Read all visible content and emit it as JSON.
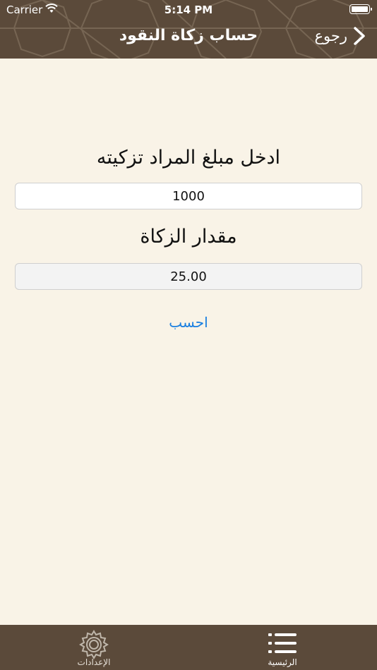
{
  "status_bar": {
    "carrier": "Carrier",
    "time": "5:14 PM"
  },
  "nav": {
    "title": "حساب زكاة النقود",
    "back_label": "رجوع"
  },
  "form": {
    "amount_label": "ادخل مبلغ المراد تزكيته",
    "amount_value": "1000",
    "zakat_label": "مقدار الزكاة",
    "zakat_value": "25.00",
    "calculate_label": "احسب"
  },
  "tabs": [
    {
      "label": "الإعدادات",
      "icon": "gear-icon",
      "active": false
    },
    {
      "label": "الرئيسية",
      "icon": "list-icon",
      "active": true
    }
  ],
  "colors": {
    "bar": "#5b4a3a",
    "background": "#f9f3e7",
    "link": "#1a7fe0"
  }
}
